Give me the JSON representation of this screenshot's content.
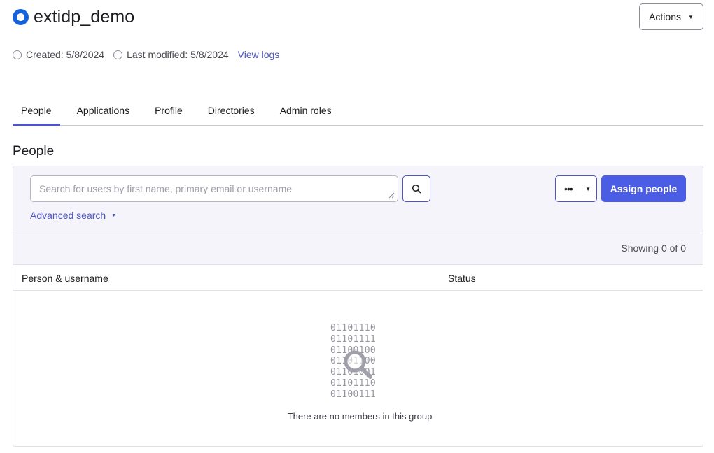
{
  "header": {
    "title": "extidp_demo",
    "actions_label": "Actions"
  },
  "meta": {
    "created": "Created: 5/8/2024",
    "modified": "Last modified: 5/8/2024",
    "view_logs": "View logs"
  },
  "tabs": [
    {
      "label": "People",
      "active": true
    },
    {
      "label": "Applications",
      "active": false
    },
    {
      "label": "Profile",
      "active": false
    },
    {
      "label": "Directories",
      "active": false
    },
    {
      "label": "Admin roles",
      "active": false
    }
  ],
  "section": {
    "title": "People"
  },
  "toolbar": {
    "search_placeholder": "Search for users by first name, primary email or username",
    "advanced_search": "Advanced search",
    "more_label": "•••",
    "assign_label": "Assign people"
  },
  "count": {
    "text": "Showing 0 of 0"
  },
  "table": {
    "columns": [
      "Person & username",
      "Status"
    ]
  },
  "empty_state": {
    "binary_lines": [
      "01101110",
      "01101111",
      "01100100",
      "01101100",
      "01101001",
      "01101110",
      "01100111"
    ],
    "message": "There are no members in this group"
  },
  "colors": {
    "accent": "#4b55c8",
    "primary_button": "#4b5ce5",
    "group_icon": "#1662dd"
  },
  "icons": {
    "group": "group-icon",
    "clock": "clock-icon",
    "search": "search-icon",
    "caret": "caret-down-icon",
    "magnifier": "magnifier-icon"
  }
}
